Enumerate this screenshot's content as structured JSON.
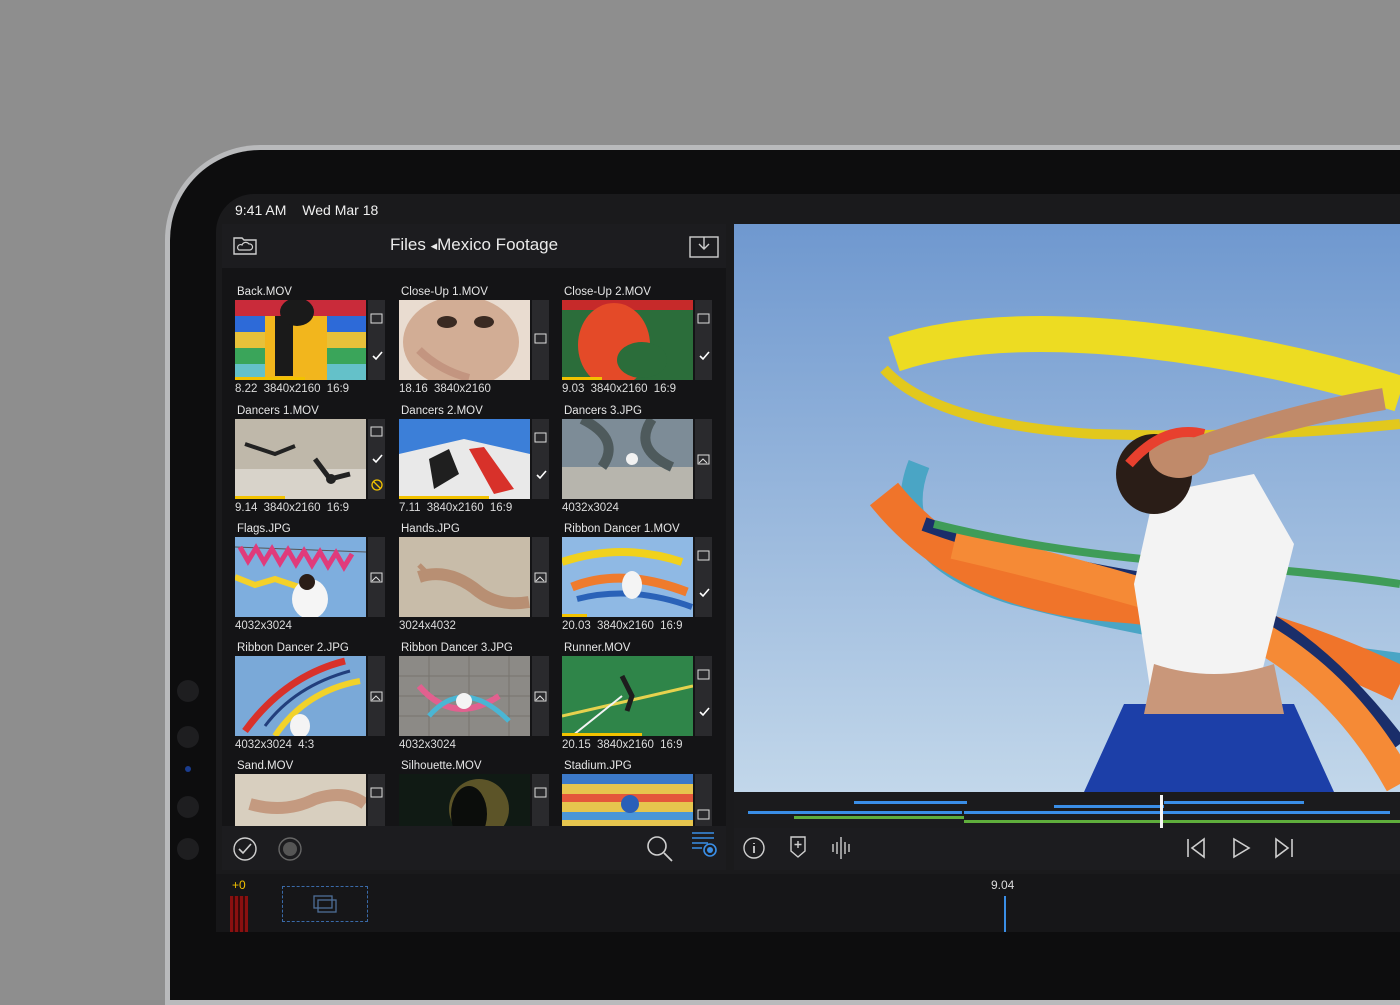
{
  "status_bar": {
    "time": "9:41 AM",
    "date": "Wed Mar 18"
  },
  "browser": {
    "breadcrumb_root": "Files",
    "breadcrumb_arrow": "◂",
    "breadcrumb_folder": "Mexico Footage",
    "clips": [
      {
        "name": "Back.MOV",
        "meta": "8.22 3840x2160 16:9"
      },
      {
        "name": "Close-Up 1.MOV",
        "meta": "18.16 3840x2160"
      },
      {
        "name": "Close-Up 2.MOV",
        "meta": "9.03 3840x2160 16:9"
      },
      {
        "name": "Dancers 1.MOV",
        "meta": "9.14 3840x2160 16:9"
      },
      {
        "name": "Dancers 2.MOV",
        "meta": "7.11 3840x2160 16:9"
      },
      {
        "name": "Dancers 3.JPG",
        "meta": "4032x3024"
      },
      {
        "name": "Flags.JPG",
        "meta": "4032x3024"
      },
      {
        "name": "Hands.JPG",
        "meta": "3024x4032"
      },
      {
        "name": "Ribbon Dancer 1.MOV",
        "meta": "20.03 3840x2160 16:9"
      },
      {
        "name": "Ribbon Dancer 2.JPG",
        "meta": "4032x3024 4:3"
      },
      {
        "name": "Ribbon Dancer 3.JPG",
        "meta": "4032x3024"
      },
      {
        "name": "Runner.MOV",
        "meta": "20.15 3840x2160 16:9"
      },
      {
        "name": "Sand.MOV",
        "meta": ""
      },
      {
        "name": "Silhouette.MOV",
        "meta": ""
      },
      {
        "name": "Stadium.JPG",
        "meta": ""
      }
    ]
  },
  "timeline": {
    "offset_label": "+0",
    "playhead_time": "9.04"
  },
  "colors": {
    "accent_blue": "#3a8ee6",
    "accent_yellow": "#f2c200",
    "accent_green": "#5fae3c",
    "panel": "#1c1c1f"
  }
}
